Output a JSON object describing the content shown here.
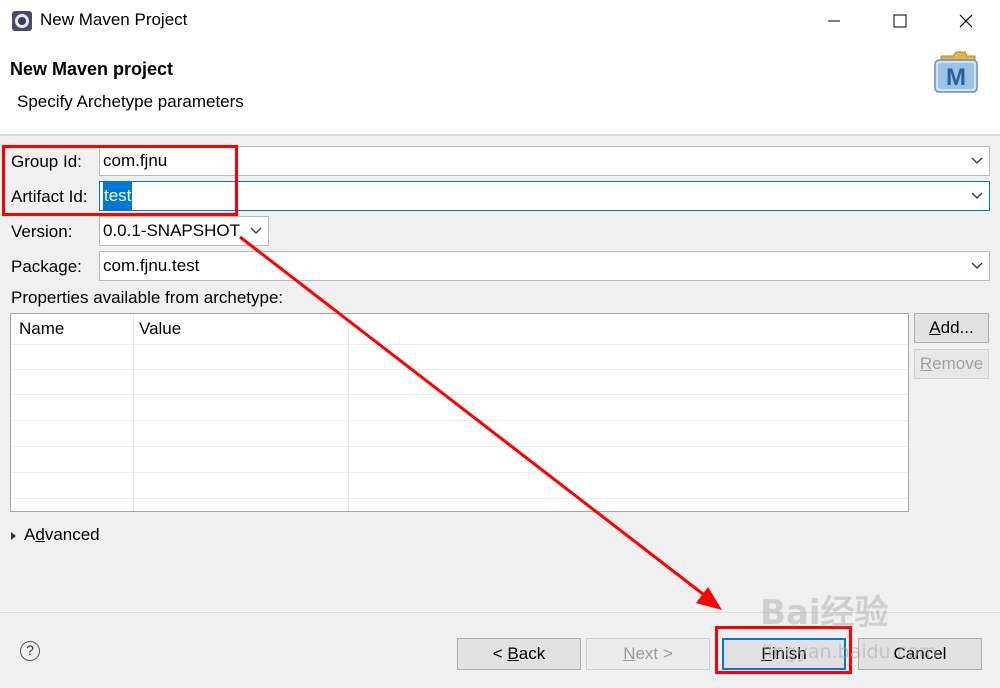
{
  "window": {
    "title": "New Maven Project",
    "minimize_glyph": "─",
    "maximize_glyph": "☐",
    "close_glyph": "✕"
  },
  "header": {
    "title": "New Maven project",
    "description": "Specify Archetype parameters",
    "logo_letter": "M"
  },
  "form": {
    "group_id": {
      "label": "Group Id:",
      "value": "com.fjnu"
    },
    "artifact_id": {
      "label": "Artifact Id:",
      "value": "test"
    },
    "version": {
      "label": "Version:",
      "value": "0.0.1-SNAPSHOT"
    },
    "package": {
      "label": "Package:",
      "value": "com.fjnu.test"
    }
  },
  "properties": {
    "label": "Properties available from archetype:",
    "columns": [
      "Name",
      "Value"
    ],
    "rows": []
  },
  "side_buttons": {
    "add": {
      "mnemonic": "A",
      "rest": "dd..."
    },
    "remove": {
      "mnemonic": "R",
      "rest": "emove"
    }
  },
  "advanced": {
    "label_prefix": "A",
    "mnemonic": "d",
    "label_rest": "vanced"
  },
  "footer": {
    "help_glyph": "?",
    "back": {
      "prefix": "< ",
      "mnemonic": "B",
      "rest": "ack"
    },
    "next": {
      "mnemonic": "N",
      "rest": "ext >"
    },
    "finish": {
      "mnemonic": "F",
      "rest": "inish"
    },
    "cancel": {
      "label": "Cancel"
    }
  },
  "watermark": {
    "text": "Bai经验",
    "sub": "jingyan.baidu.com"
  },
  "colors": {
    "accent": "#0078d7",
    "annotation_red": "#ff0000",
    "dialog_bg": "#f0f0f0"
  }
}
